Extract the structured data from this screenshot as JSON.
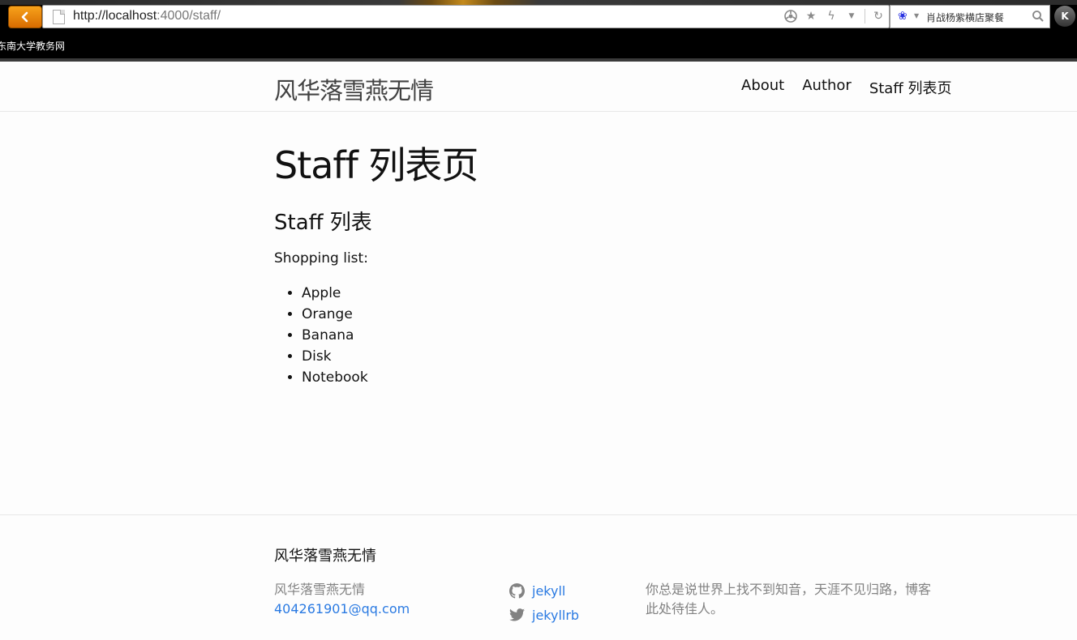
{
  "browser": {
    "url_host": "http://localhost",
    "url_path": ":4000/staff/",
    "search_text": "肖战杨紫横店聚餐",
    "bookmark": "东南大学教务网",
    "profile_initial": "K"
  },
  "header": {
    "site_title": "风华落雪燕无情",
    "nav": [
      "About",
      "Author",
      "Staff 列表页"
    ]
  },
  "main": {
    "page_title": "Staff 列表页",
    "section_title": "Staff 列表",
    "intro": "Shopping list:",
    "items": [
      "Apple",
      "Orange",
      "Banana",
      "Disk",
      "Notebook"
    ]
  },
  "footer": {
    "heading": "风华落雪燕无情",
    "name": "风华落雪燕无情",
    "email": "404261901@qq.com",
    "github": "jekyll",
    "twitter": "jekyllrb",
    "description": "你总是说世界上找不到知音，天涯不见归路，博客此处待佳人。"
  },
  "colors": {
    "link": "#2a7ae2",
    "muted": "#828282",
    "back_button": "#f08c0e"
  }
}
